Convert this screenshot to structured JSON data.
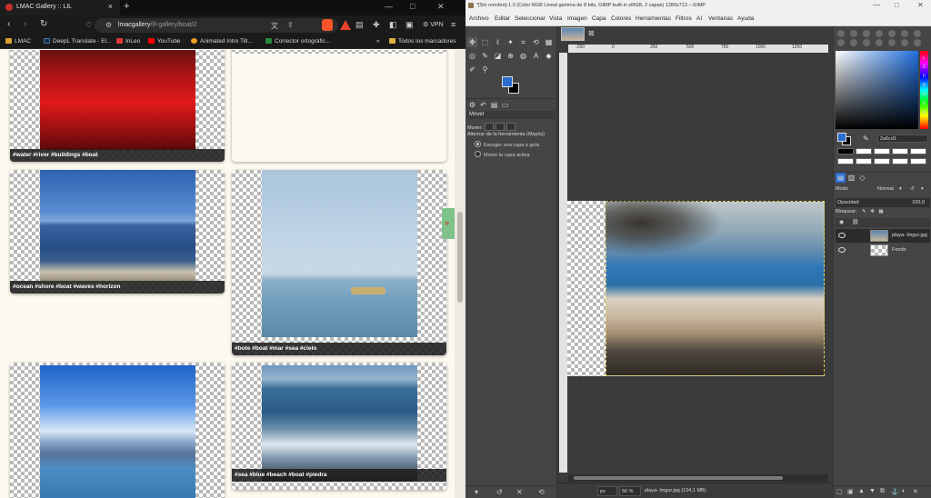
{
  "browser": {
    "tab_title": "LMAC Gallery :: LIL",
    "new_tab": "+",
    "url_host": "lmacgallery",
    "url_path": "/lil-gallery/boat/2",
    "vpn_label": "VPN",
    "bookmarks": [
      {
        "label": "LMAC",
        "color": "#e0a030"
      },
      {
        "label": "DeepL Translate - El...",
        "color": "#0f2b46"
      },
      {
        "label": "InLeo",
        "color": "#e23838"
      },
      {
        "label": "YouTube",
        "color": "#ff0000"
      },
      {
        "label": "Animated Intro Titl...",
        "color": "#f0a020"
      },
      {
        "label": "Corrector ortográfic...",
        "color": "#2a8a3a"
      }
    ],
    "bookmarks_more": "»",
    "all_bookmarks": "Todos los marcadores"
  },
  "gallery": {
    "cards": [
      {
        "caption": "#water #river #buildings #boat",
        "photo": "red boat interior"
      },
      {
        "caption": "#ocean #shore #boat #waves #horizon",
        "photo": "ocean shore"
      },
      {
        "caption": "#bote #boat #mar #sea #cielo",
        "photo": "seagulls and boat"
      },
      {
        "caption": "",
        "photo": "harbor with mountains"
      },
      {
        "caption": "#sea #blue #beach #boat #piedra",
        "photo": "crashing waves"
      }
    ]
  },
  "gimp": {
    "window_title": "*[Sin nombre]-1.0 (Color RGB Lineal gamma de 8 bits, GIMP built-in sRGB, 2 capas) 1280x713 – GIMP",
    "menu": [
      "Archivo",
      "Editar",
      "Seleccionar",
      "Vista",
      "Imagen",
      "Capa",
      "Colores",
      "Herramientas",
      "Filtros",
      "AI",
      "Ventanas",
      "Ayuda"
    ],
    "tool_options": {
      "title": "Mover",
      "mode_label": "Mover:",
      "toggle_label": "Alternar de la herramienta (Mayús)",
      "option1": "Escoger una capa o guía",
      "option2": "Mover la capa activa"
    },
    "ruler_marks": [
      "-250",
      "0",
      "250",
      "500",
      "750",
      "1000",
      "1250"
    ],
    "status": {
      "unit": "px",
      "zoom": "50 %",
      "info": "playa- lmgur.jpg (104,1 MB)"
    },
    "fg_color": "#2a6cd1",
    "bg_color": "#000000",
    "hex_value": "2a6cd1",
    "hue_labels": [
      "L",
      "C",
      "h",
      "R",
      "G",
      "B",
      "A"
    ],
    "layers": {
      "mode_label": "Modo",
      "mode_value": "Normal",
      "opacity_label": "Opacidad",
      "opacity_value": "100,0",
      "lock_label": "Bloquear:",
      "items": [
        {
          "name": "playa- lmgur.jpg"
        },
        {
          "name": "Fondo"
        }
      ]
    }
  }
}
